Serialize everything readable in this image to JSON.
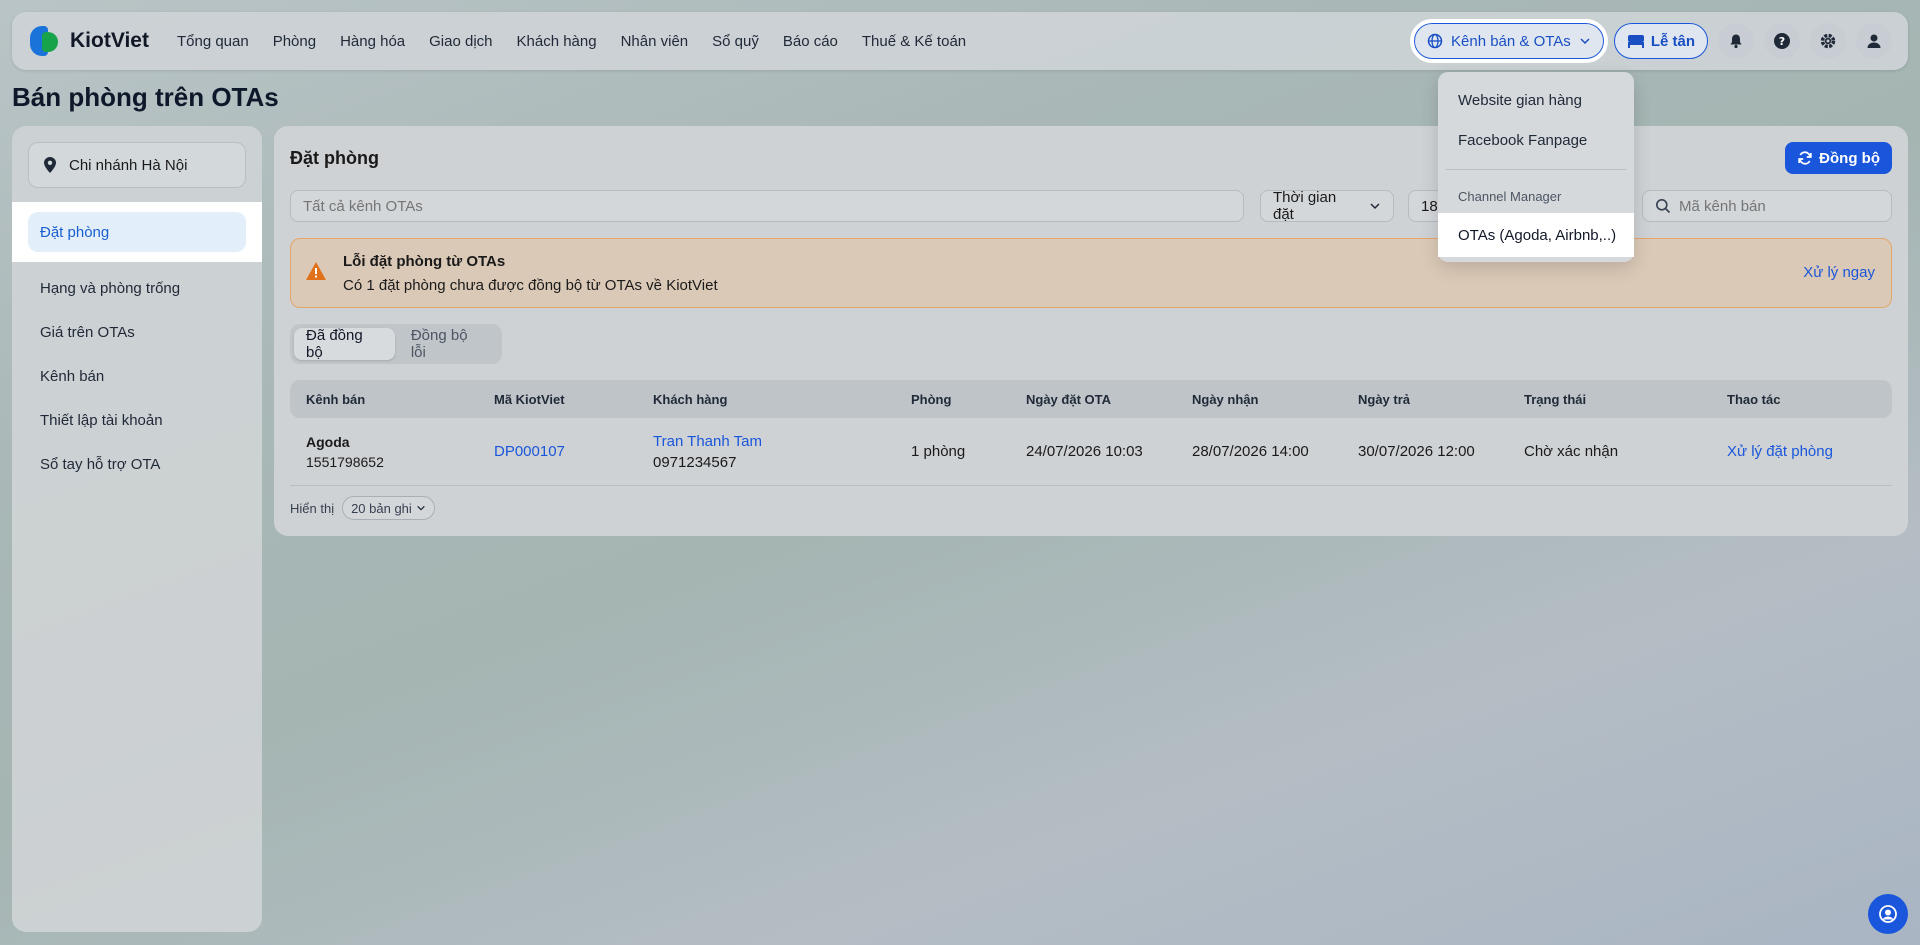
{
  "brand": {
    "name": "KiotViet",
    "colors": {
      "blue": "#1a73d9",
      "green": "#17a34a",
      "accent": "#1a56db"
    }
  },
  "nav": {
    "items": [
      {
        "label": "Tổng quan"
      },
      {
        "label": "Phòng"
      },
      {
        "label": "Hàng hóa"
      },
      {
        "label": "Giao dịch"
      },
      {
        "label": "Khách hàng"
      },
      {
        "label": "Nhân viên"
      },
      {
        "label": "Sổ quỹ"
      },
      {
        "label": "Báo cáo"
      },
      {
        "label": "Thuế & Kế toán"
      }
    ]
  },
  "topright": {
    "channels_label": "Kênh bán & OTAs",
    "reception_label": "Lễ tân",
    "icons": [
      "globe-icon",
      "bed-icon",
      "bell-icon",
      "help-icon",
      "gear-icon",
      "user-icon"
    ]
  },
  "page": {
    "title": "Bán phòng trên OTAs"
  },
  "sidebar": {
    "branch": "Chi nhánh Hà Nội",
    "active": "Đặt phòng",
    "items": [
      {
        "label": "Hạng và phòng trống"
      },
      {
        "label": "Giá trên OTAs"
      },
      {
        "label": "Kênh bán"
      },
      {
        "label": "Thiết lập tài khoản"
      },
      {
        "label": "Sổ tay hỗ trợ OTA"
      }
    ]
  },
  "main": {
    "title": "Đặt phòng",
    "sync_label": "Đồng bộ",
    "filters": {
      "ota_placeholder": "Tất cả kênh OTAs",
      "time_label": "Thời gian đặt",
      "date_partial": "18,",
      "search_placeholder": "Mã kênh bán"
    },
    "alert": {
      "title": "Lỗi đặt phòng từ OTAs",
      "desc": "Có 1 đặt phòng chưa được đồng bộ từ OTAs về KiotViet",
      "action": "Xử lý ngay"
    },
    "tabs": [
      {
        "label": "Đã đồng bộ",
        "active": true
      },
      {
        "label": "Đồng bộ lỗi",
        "active": false
      }
    ],
    "table": {
      "headers": [
        "Kênh bán",
        "Mã KiotViet",
        "Khách hàng",
        "Phòng",
        "Ngày đặt OTA",
        "Ngày nhận",
        "Ngày trả",
        "Trạng thái",
        "Thao tác"
      ],
      "rows": [
        {
          "channel": "Agoda",
          "channel_code": "1551798652",
          "kv_code": "DP000107",
          "customer": "Tran Thanh Tam",
          "phone": "0971234567",
          "rooms": "1 phòng",
          "ota_date": "24/07/2026 10:03",
          "checkin": "28/07/2026 14:00",
          "checkout": "30/07/2026 12:00",
          "status": "Chờ xác nhận",
          "action": "Xử lý đặt phòng"
        }
      ]
    },
    "pager": {
      "label": "Hiển thị",
      "size": "20 bản ghi"
    }
  },
  "dropdown": {
    "items": [
      {
        "label": "Website gian hàng"
      },
      {
        "label": "Facebook Fanpage"
      }
    ],
    "group_label": "Channel Manager",
    "active_item": "OTAs (Agoda, Airbnb,..)"
  }
}
